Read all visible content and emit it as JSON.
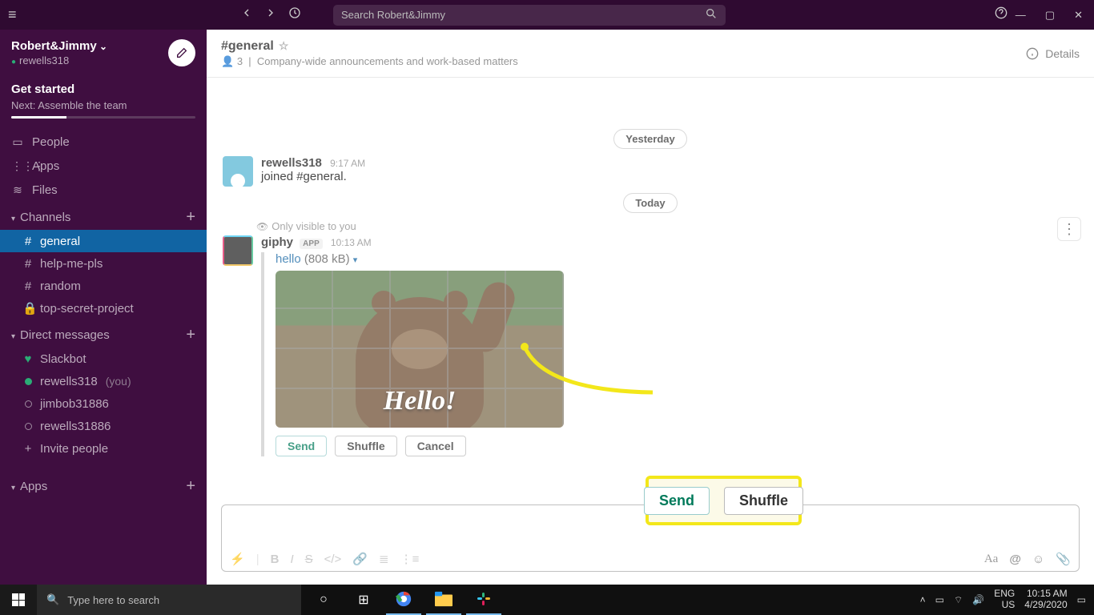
{
  "titlebar": {
    "search_placeholder": "Search Robert&Jimmy"
  },
  "workspace": {
    "name": "Robert&Jimmy",
    "user": "rewells318"
  },
  "get_started": {
    "title": "Get started",
    "next": "Next: Assemble the team"
  },
  "nav": {
    "people": "People",
    "apps": "Apps",
    "files": "Files"
  },
  "sections": {
    "channels": "Channels",
    "dms": "Direct messages",
    "apps": "Apps",
    "invite": "Invite people"
  },
  "channels": [
    {
      "name": "general",
      "prefix": "#",
      "active": true
    },
    {
      "name": "help-me-pls",
      "prefix": "#"
    },
    {
      "name": "random",
      "prefix": "#"
    },
    {
      "name": "top-secret-project",
      "prefix": "🔒"
    }
  ],
  "dms": [
    {
      "name": "Slackbot",
      "icon": "heart",
      "color": "#2BAC76"
    },
    {
      "name": "rewells318",
      "online": true,
      "you": "(you)"
    },
    {
      "name": "jimbob31886",
      "online": false
    },
    {
      "name": "rewells31886",
      "online": false
    }
  ],
  "channel_header": {
    "name": "#general",
    "members": "3",
    "topic": "Company-wide announcements and work-based matters",
    "details": "Details"
  },
  "dividers": {
    "yesterday": "Yesterday",
    "today": "Today"
  },
  "msg1": {
    "author": "rewells318",
    "time": "9:17 AM",
    "text": "joined #general."
  },
  "ephemeral": "Only visible to you",
  "msg2": {
    "author": "giphy",
    "badge": "APP",
    "time": "10:13 AM",
    "link": "hello",
    "size": "(808 kB)",
    "gif_text": "Hello!",
    "buttons": {
      "send": "Send",
      "shuffle": "Shuffle",
      "cancel": "Cancel"
    }
  },
  "callout": {
    "send": "Send",
    "shuffle": "Shuffle"
  },
  "taskbar": {
    "search": "Type here to search",
    "lang1": "ENG",
    "lang2": "US",
    "time": "10:15 AM",
    "date": "4/29/2020"
  }
}
